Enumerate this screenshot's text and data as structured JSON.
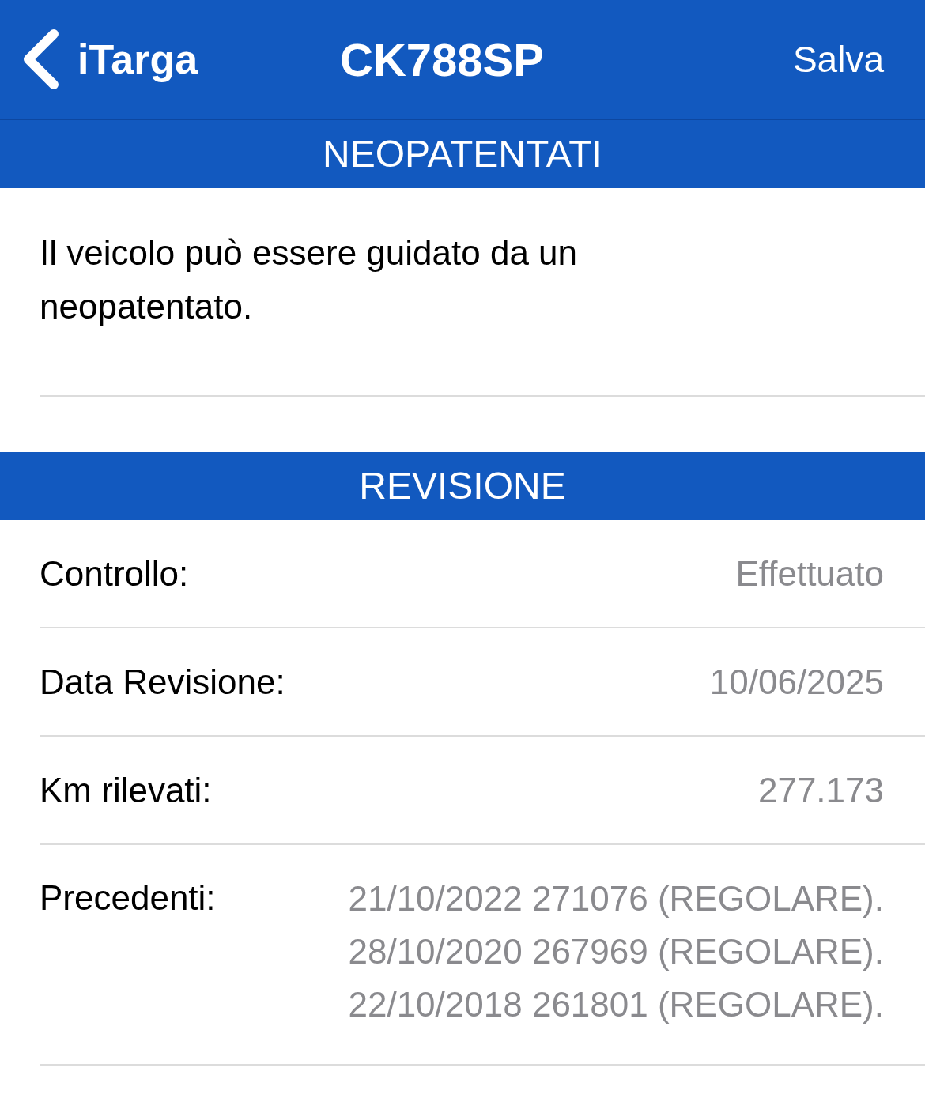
{
  "nav_bar": {
    "back_label": "iTarga",
    "title": "CK788SP",
    "action": "Salva"
  },
  "sections": [
    {
      "header": "NEOPATENTATI",
      "kind": "text",
      "text": "Il veicolo può essere guidato da un neopatentato."
    },
    {
      "header": "REVISIONE",
      "kind": "rows",
      "rows": [
        {
          "label": "Controllo:",
          "values": [
            "Effettuato"
          ]
        },
        {
          "label": "Data Revisione:",
          "values": [
            "10/06/2025"
          ]
        },
        {
          "label": "Km rilevati:",
          "values": [
            "277.173"
          ]
        },
        {
          "label": "Precedenti:",
          "values": [
            "21/10/2022 271076 (REGOLARE).",
            "28/10/2020 267969 (REGOLARE).",
            "22/10/2018 261801 (REGOLARE)."
          ]
        }
      ]
    }
  ]
}
